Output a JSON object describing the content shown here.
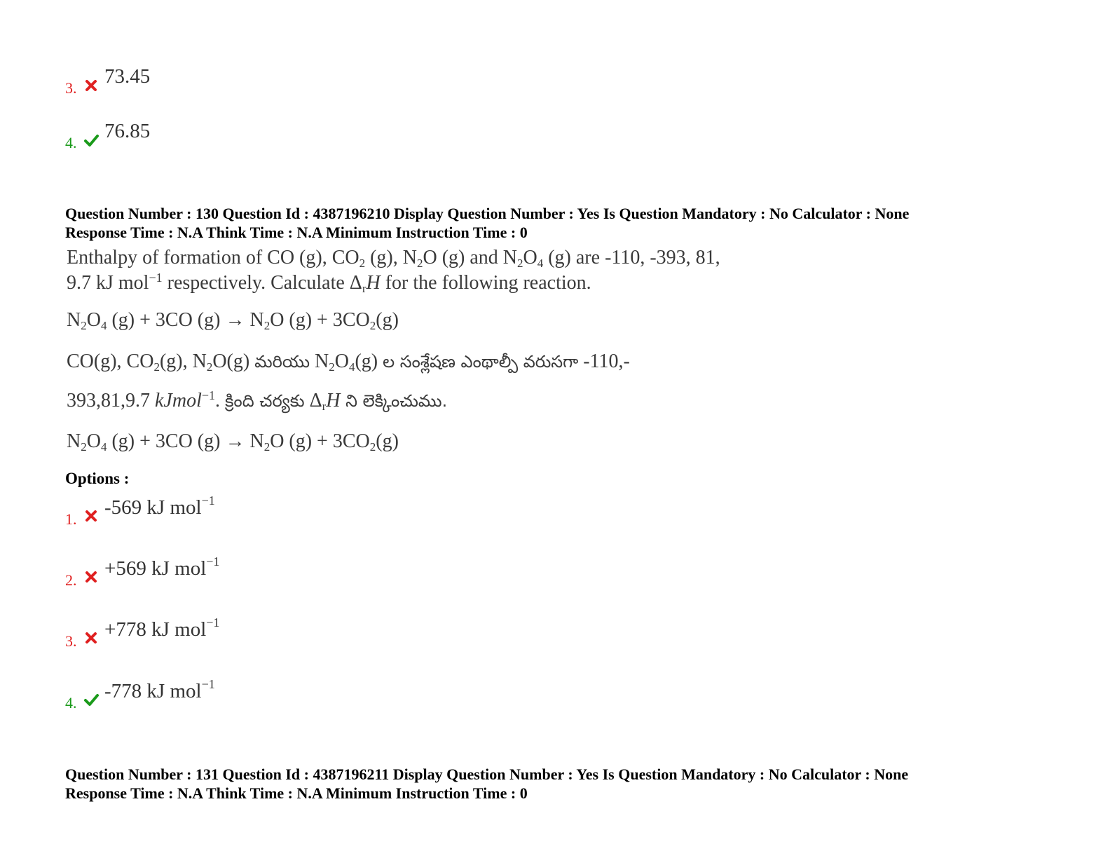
{
  "prev_options": [
    {
      "num": "3.",
      "status": "wrong",
      "value": "73.45"
    },
    {
      "num": "4.",
      "status": "correct",
      "value": "76.85"
    }
  ],
  "q130": {
    "meta_line1": "Question Number : 130 Question Id : 4387196210 Display Question Number : Yes Is Question Mandatory : No Calculator : None",
    "meta_line2": "Response Time : N.A Think Time : N.A Minimum Instruction Time : 0",
    "en": {
      "t1": "Enthalpy of formation of CO (g), CO",
      "t1_sub1": "2",
      "t2": " (g), N",
      "t2_sub": "2",
      "t3": "O (g) and N",
      "t3_sub1": "2",
      "t3b": "O",
      "t3_sub2": "4",
      "t4": " (g) are -110, -393, 81,",
      "l2a": "9.7 kJ mol",
      "l2_sup": "−1",
      "l2b": " respectively.  Calculate Δ",
      "l2_sub": "r",
      "l2_H": "H",
      "l2c": " for the following reaction."
    },
    "reaction": {
      "a": "N",
      "a_sub": "2",
      "b": "O",
      "b_sub": "4",
      "c": " (g) + 3CO (g) → N",
      "c_sub": "2",
      "d": "O (g) + 3CO",
      "d_sub": "2",
      "e": "(g)"
    },
    "te": {
      "l1a": "CO(g),  CO",
      "l1_sub1": "2",
      "l1b": "(g),  N",
      "l1_sub2": "2",
      "l1c": "O(g)  ",
      "l1_te1": "మరియు",
      "l1d": "   N",
      "l1_sub3": "2",
      "l1e": "O",
      "l1_sub4": "4",
      "l1f": "(g)  ",
      "l1_te2": "ల  సంశ్లేషణ  ఎంథాల్పీ  వరుసగా",
      "l1g": "  -110,-",
      "l2a": "393,81,9.7 ",
      "l2_unit": "kJmol",
      "l2_sup": "−1",
      "l2b": ".  ",
      "l2_te1": "క్రింది చర్యకు",
      "l2c": " Δ",
      "l2_sub": "r",
      "l2_H": "H",
      "l2_te2": " ని లెక్కించుము."
    },
    "options_label": "Options :",
    "options": [
      {
        "num": "1.",
        "status": "wrong",
        "value": "-569 kJ mol",
        "sup": "−1"
      },
      {
        "num": "2.",
        "status": "wrong",
        "value": "+569 kJ mol",
        "sup": "−1"
      },
      {
        "num": "3.",
        "status": "wrong",
        "value": "+778 kJ mol",
        "sup": "−1"
      },
      {
        "num": "4.",
        "status": "correct",
        "value": "-778 kJ mol",
        "sup": "−1"
      }
    ]
  },
  "q131": {
    "meta_line1": "Question Number : 131 Question Id : 4387196211 Display Question Number : Yes Is Question Mandatory : No Calculator : None",
    "meta_line2": "Response Time : N.A Think Time : N.A Minimum Instruction Time : 0"
  },
  "colors": {
    "wrong": "#e02020",
    "correct": "#1a9a1a"
  },
  "icons": {
    "wrong": "cross-icon",
    "correct": "check-icon"
  }
}
